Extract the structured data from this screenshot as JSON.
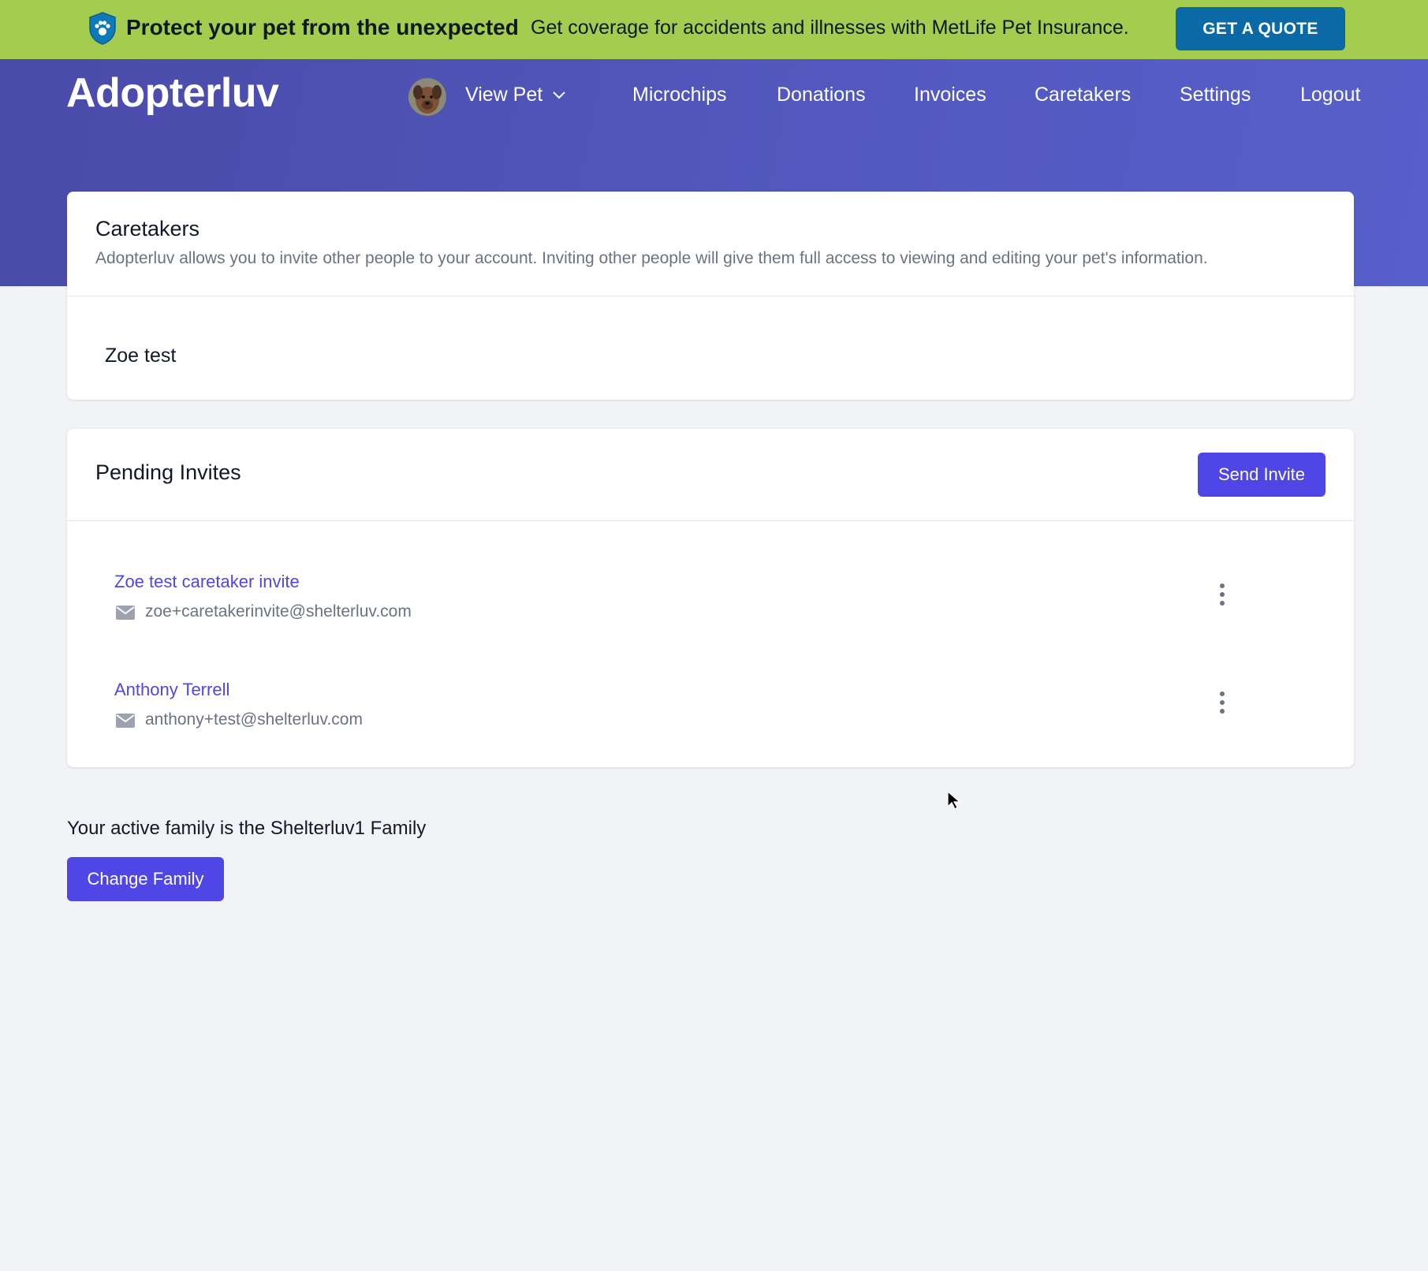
{
  "promo": {
    "headline": "Protect your pet from the unexpected",
    "subtext": "Get coverage for accidents and illnesses with MetLife Pet Insurance.",
    "cta_label": "GET A QUOTE",
    "icon": "shield-paw-icon"
  },
  "header": {
    "brand": "Adopterluv",
    "view_pet_label": "View Pet",
    "nav": [
      "Microchips",
      "Donations",
      "Invoices",
      "Caretakers",
      "Settings",
      "Logout"
    ]
  },
  "caretakers": {
    "title": "Caretakers",
    "description": "Adopterluv allows you to invite other people to your account. Inviting other people will give them full access to viewing and editing your pet's information.",
    "items": [
      {
        "name": "Zoe test"
      }
    ]
  },
  "pending": {
    "title": "Pending Invites",
    "send_label": "Send Invite",
    "invites": [
      {
        "name": "Zoe test caretaker invite",
        "email": "zoe+caretakerinvite@shelterluv.com"
      },
      {
        "name": "Anthony Terrell",
        "email": "anthony+test@shelterluv.com"
      }
    ]
  },
  "family": {
    "text": "Your active family is the Shelterluv1 Family",
    "change_label": "Change Family"
  },
  "colors": {
    "promo_bg": "#a4cc4e",
    "quote_btn": "#0b6aa5",
    "header_bg": "#5157bb",
    "accent": "#4f46e5",
    "page_bg": "#f2f3f7"
  }
}
